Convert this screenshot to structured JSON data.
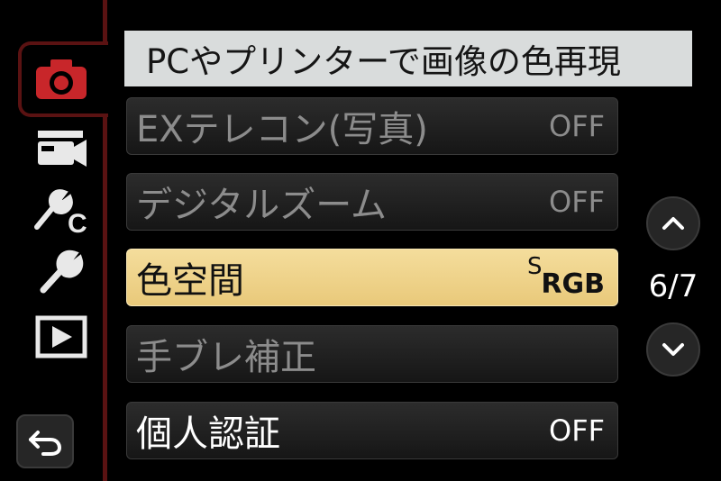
{
  "header": {
    "title": "PCやプリンターで画像の色再現"
  },
  "sidebar": {
    "tabs": [
      {
        "icon": "camera-icon",
        "active": true
      },
      {
        "icon": "video-camera-icon",
        "active": false
      },
      {
        "icon": "custom-settings-icon",
        "active": false
      },
      {
        "icon": "wrench-icon",
        "active": false
      },
      {
        "icon": "playback-icon",
        "active": false
      }
    ],
    "back_icon": "back-arrow-icon",
    "custom_label": "C"
  },
  "menu": {
    "items": [
      {
        "label": "EXテレコン(写真)",
        "value": "OFF",
        "state": "dim"
      },
      {
        "label": "デジタルズーム",
        "value": "OFF",
        "state": "dim"
      },
      {
        "label": "色空間",
        "value_sup": "S",
        "value_main": "RGB",
        "state": "selected"
      },
      {
        "label": "手ブレ補正",
        "value": "",
        "state": "dim"
      },
      {
        "label": "個人認証",
        "value": "OFF",
        "state": "bright"
      }
    ]
  },
  "pagination": {
    "indicator": "6/7",
    "up_icon": "chevron-up-icon",
    "down_icon": "chevron-down-icon"
  },
  "colors": {
    "accent": "#5a1212",
    "selected": "#f0d68c",
    "header_bg": "#d9dcdc"
  }
}
